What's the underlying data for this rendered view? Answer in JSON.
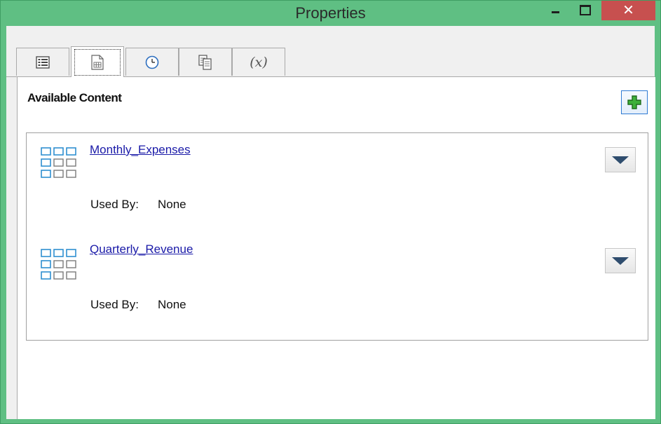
{
  "window": {
    "title": "Properties",
    "minimize_label": "‒",
    "maximize_label": "□",
    "close_label": "✕",
    "accent_color": "#5fbf83",
    "close_color": "#c7504f"
  },
  "tabs": [
    {
      "icon": "list-icon",
      "label": ""
    },
    {
      "icon": "content-icon",
      "label": "",
      "active": true
    },
    {
      "icon": "clock-icon",
      "label": ""
    },
    {
      "icon": "copy-icon",
      "label": ""
    },
    {
      "icon": "variable-icon",
      "label": "(x)"
    }
  ],
  "panel": {
    "title": "Available Content",
    "add_icon": "add-icon"
  },
  "items": [
    {
      "name": "Monthly_Expenses",
      "used_by_label": "Used By:",
      "used_by_value": "None",
      "icon": "grid-icon"
    },
    {
      "name": "Quarterly_Revenue",
      "used_by_label": "Used By:",
      "used_by_value": "None",
      "icon": "grid-icon"
    }
  ]
}
